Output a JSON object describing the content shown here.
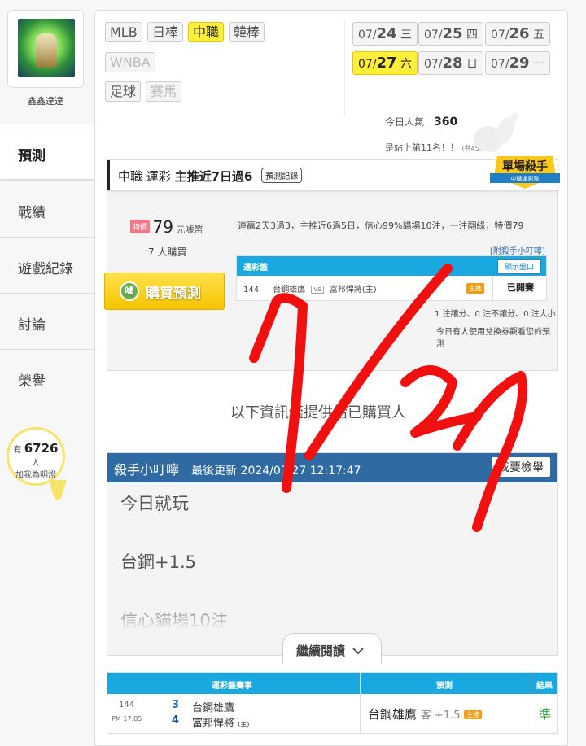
{
  "sidebar": {
    "username": "鑫鑫達達",
    "nav": [
      "預測",
      "戰績",
      "遊戲紀錄",
      "討論",
      "榮譽"
    ],
    "fans_prefix": "有",
    "fans_count": "6726",
    "fans_suffix": "人",
    "fans_label": "加我為明燈"
  },
  "leagues": {
    "row1": [
      "MLB",
      "日棒",
      "中職",
      "韓棒"
    ],
    "row2": [
      "WNBA"
    ],
    "row3": [
      "足球",
      "賽馬"
    ],
    "active": "中職"
  },
  "dates": [
    {
      "md": "07/",
      "day": "24",
      "wd": "三"
    },
    {
      "md": "07/",
      "day": "25",
      "wd": "四"
    },
    {
      "md": "07/",
      "day": "26",
      "wd": "五"
    },
    {
      "md": "07/",
      "day": "27",
      "wd": "六"
    },
    {
      "md": "07/",
      "day": "28",
      "wd": "日"
    },
    {
      "md": "07/",
      "day": "29",
      "wd": "一"
    }
  ],
  "popularity": {
    "label": "今日人氣",
    "value": "360",
    "rank_text": "是站上第11名！！",
    "total": "(共4594人)"
  },
  "prediction": {
    "title_prefix": "中職 運彩",
    "title_bold": "主推近7日過6",
    "record_button": "預測記錄",
    "badge_line1": "單場殺手",
    "badge_line2": "中職運彩盤",
    "price_tag": "特價",
    "price": "79",
    "price_unit": "元噱幣",
    "buyers": "7 人購買",
    "buy_button": "購買預測",
    "description": "連贏2天3過3，主推近6過5日，信心99%貓場10注，一注翻綠，特價79",
    "attach_link": "[附殺手小叮嚀]",
    "table_title": "運彩盤",
    "show_button": "顯示盤口",
    "game_no": "144",
    "team_away": "台鋼雄鷹",
    "team_home": "富邦悍將(主)",
    "vs": "VS",
    "zhu": "主推",
    "status": "已開賽",
    "note1": "1 注讓分、0 注不讓分、0 注大小",
    "note2": "今日有人使用兌換券觀看您的預測"
  },
  "info_notice": "以下資訊僅提供給已購買人",
  "tips": {
    "title": "殺手小叮嚀",
    "updated": "最後更新 2024/07/27 12:17:47",
    "report_button": "我要檢舉",
    "lines": [
      "今日就玩",
      "台鋼+1.5",
      "信心貓場10注"
    ],
    "more_button": "繼續閱讀"
  },
  "game_table": {
    "headers": [
      "運彩盤賽事",
      "預測",
      "結果"
    ],
    "game_no": "144",
    "game_time": "PM 17:05",
    "score_away": "3",
    "score_home": "4",
    "team_away": "台鋼雄鷹",
    "team_home": "富邦悍將",
    "home_mark": "(主)",
    "pred_team": "台鋼雄鷹",
    "pred_line": "客 +1.5",
    "pred_tag": "主推",
    "result": "準"
  },
  "colors": {
    "accent_yellow": "#ffef3a",
    "header_blue": "#1aa8e0",
    "tips_blue": "#2f6aa3",
    "annotation_red": "#f01010",
    "result_green": "#2a9d3a"
  }
}
